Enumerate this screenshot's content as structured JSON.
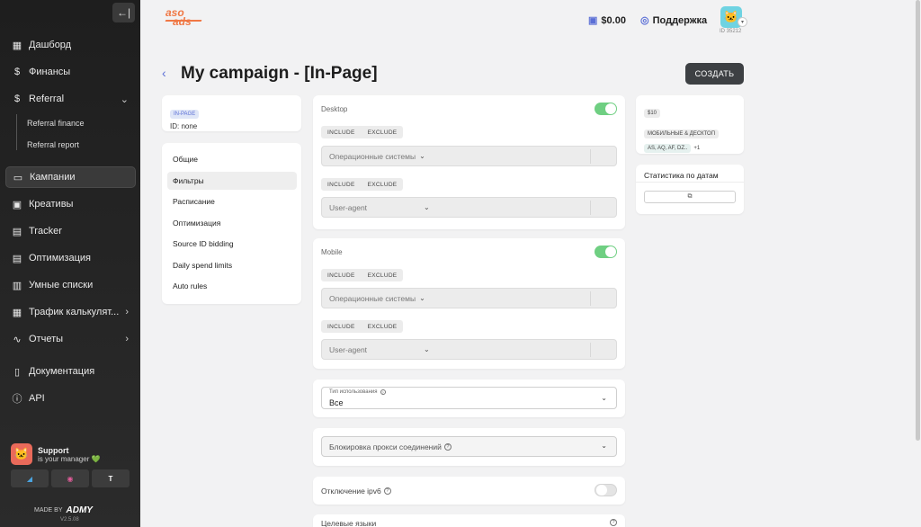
{
  "sidebar": {
    "collapse_icon": "←|",
    "items": [
      {
        "label": "Дашборд",
        "icon": "grid-icon"
      },
      {
        "label": "Финансы",
        "icon": "dollar-icon"
      },
      {
        "label": "Referral",
        "icon": "dollar-icon"
      },
      {
        "label": "Кампании",
        "icon": "monitor-icon"
      },
      {
        "label": "Креативы",
        "icon": "image-icon"
      },
      {
        "label": "Tracker",
        "icon": "document-icon"
      },
      {
        "label": "Оптимизация",
        "icon": "document-icon"
      },
      {
        "label": "Умные списки",
        "icon": "list-icon"
      },
      {
        "label": "Трафик калькулят...",
        "icon": "calculator-icon"
      },
      {
        "label": "Отчеты",
        "icon": "pulse-icon"
      },
      {
        "label": "Документация",
        "icon": "book-icon"
      },
      {
        "label": "API",
        "icon": "info-icon"
      }
    ],
    "sub_items": [
      "Referral finance",
      "Referral report"
    ],
    "support_title": "Support",
    "support_sub": "is your manager 💚",
    "made_by": "MADE BY",
    "made_by_logo": "ADMY",
    "version": "V2.5.08"
  },
  "header": {
    "brand_line1": "aso",
    "brand_line2": "ads",
    "balance": "$0.00",
    "support": "Поддержка",
    "user_id": "ID 35212"
  },
  "page": {
    "title": "My campaign - [In-Page]",
    "create": "СОЗДАТЬ"
  },
  "campaign_info": {
    "tag": "IN-PAGE",
    "id": "ID: none"
  },
  "menu": [
    "Общие",
    "Фильтры",
    "Расписание",
    "Оптимизация",
    "Source ID bidding",
    "Daily spend limits",
    "Auto rules"
  ],
  "filters": {
    "desktop_title": "Desktop",
    "mobile_title": "Mobile",
    "include": "INCLUDE",
    "exclude": "EXCLUDE",
    "os_placeholder": "Операционные системы",
    "ua_placeholder": "User-agent",
    "usage_type_label": "Тип использования",
    "usage_type_value": "Все",
    "proxy_label": "Блокировка прокси соединений",
    "ipv6_label": "Отключение ipv6",
    "target_langs_label": "Целевые языки"
  },
  "summary": {
    "price": "$10",
    "platform": "МОБИЛЬНЫЕ & ДЕСКТОП",
    "geos": "AS, AQ, AF, DZ..",
    "geos_more": "+1",
    "stats_title": "Статистика по датам"
  }
}
